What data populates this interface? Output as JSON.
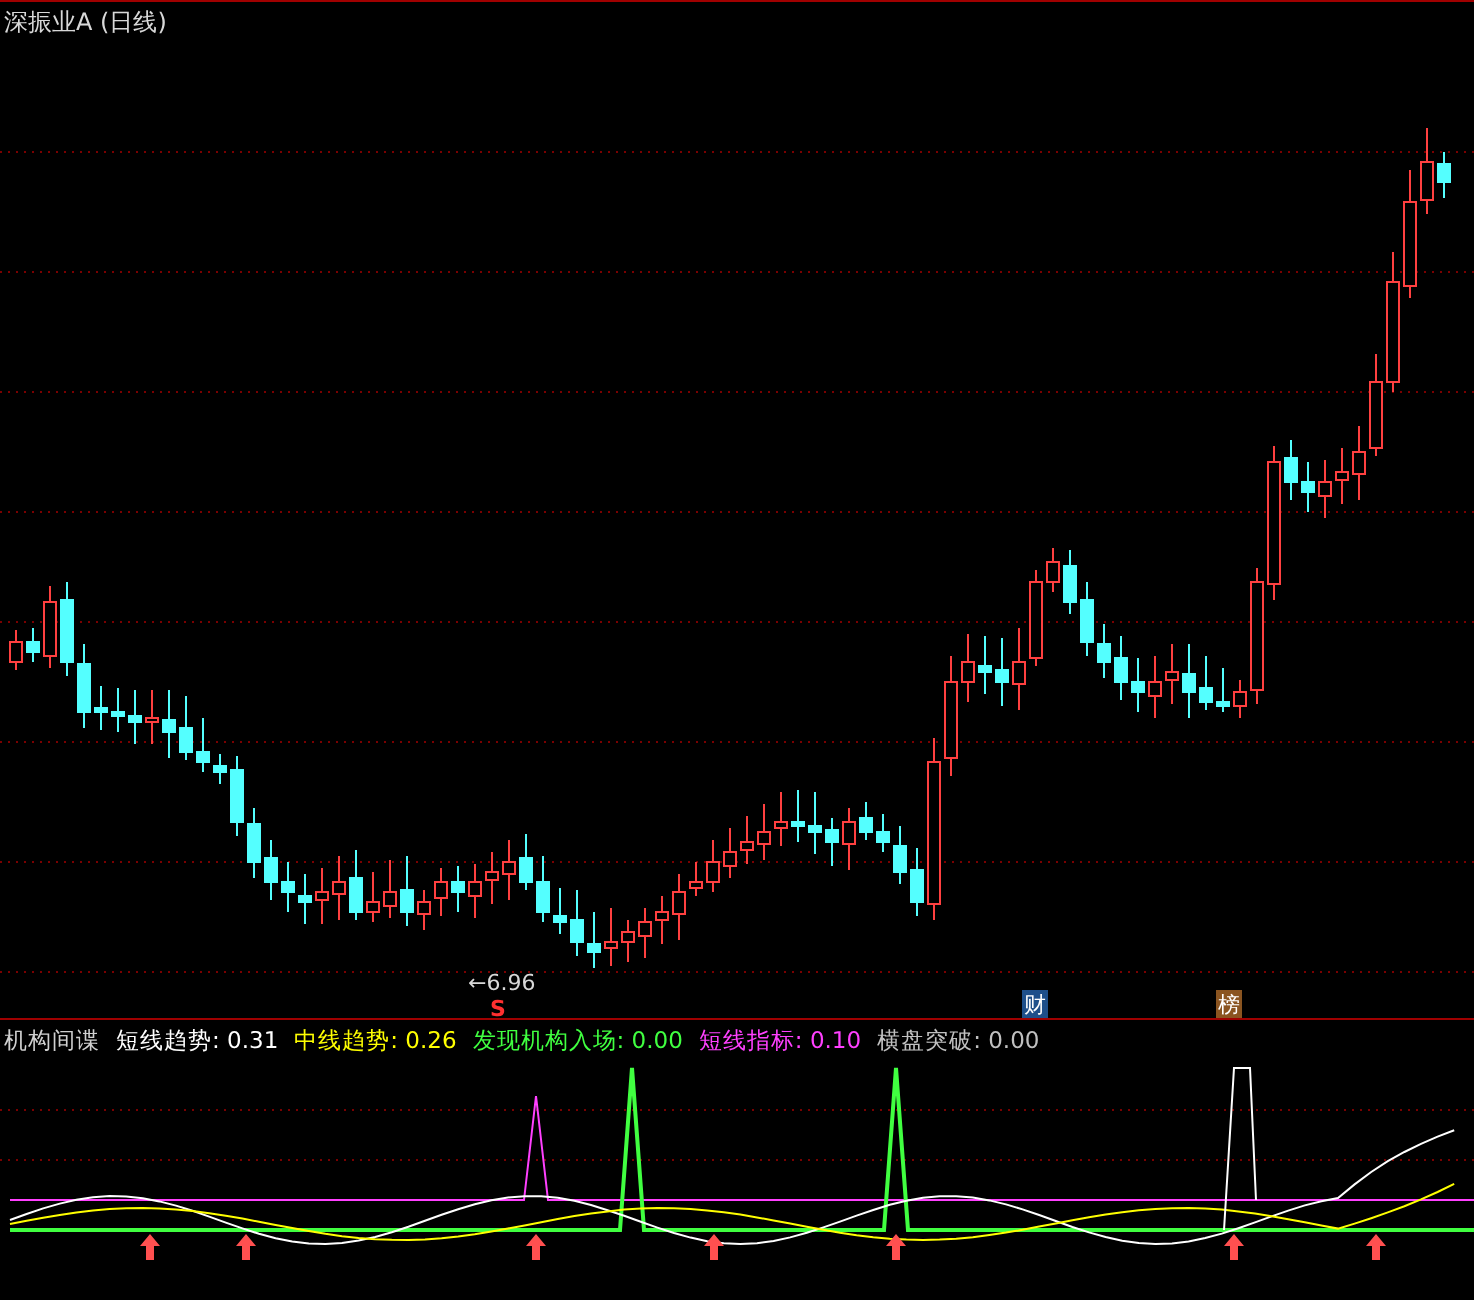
{
  "price_panel": {
    "title": "深振业A (日线)",
    "low_marker": "←6.96",
    "signal_marker": "S",
    "events": [
      {
        "label": "财",
        "color": "#1e4f8a"
      },
      {
        "label": "榜",
        "color": "#8a5420"
      }
    ]
  },
  "indicator_panel": {
    "name": "机构间谍",
    "legend": [
      {
        "label": "短线趋势:",
        "value": "0.31",
        "color": "#ffffff"
      },
      {
        "label": "中线趋势:",
        "value": "0.26",
        "color": "#ffff00"
      },
      {
        "label": "发现机构入场:",
        "value": "0.00",
        "color": "#40ff40"
      },
      {
        "label": "短线指标:",
        "value": "0.10",
        "color": "#ff40ff"
      },
      {
        "label": "横盘突破:",
        "value": "0.00",
        "color": "#c0c0c0"
      }
    ]
  }
}
